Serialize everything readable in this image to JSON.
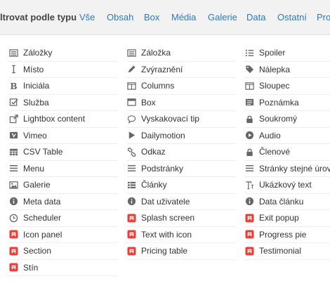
{
  "filter": {
    "label": "ltrovat podle typu",
    "tabs": [
      "Vše",
      "Obsah",
      "Box",
      "Média",
      "Galerie",
      "Data",
      "Ostatní",
      "Pro"
    ]
  },
  "columns": [
    [
      {
        "label": "Záložky",
        "icon": "list-icon"
      },
      {
        "label": "Místo",
        "icon": "spacer-icon"
      },
      {
        "label": "Iniciála",
        "icon": "dropcap-icon"
      },
      {
        "label": "Služba",
        "icon": "check-square-icon"
      },
      {
        "label": "Lightbox content",
        "icon": "external-link-icon"
      },
      {
        "label": "Vimeo",
        "icon": "vimeo-icon"
      },
      {
        "label": "CSV Table",
        "icon": "table-icon"
      },
      {
        "label": "Menu",
        "icon": "menu-icon"
      },
      {
        "label": "Galerie",
        "icon": "image-icon"
      },
      {
        "label": "Meta data",
        "icon": "info-icon"
      },
      {
        "label": "Scheduler",
        "icon": "clock-icon"
      },
      {
        "label": "Icon panel",
        "icon": "red-addon-icon"
      },
      {
        "label": "Section",
        "icon": "red-addon-icon"
      },
      {
        "label": "Stín",
        "icon": "red-addon-icon"
      }
    ],
    [
      {
        "label": "Záložka",
        "icon": "list-icon"
      },
      {
        "label": "Zvýraznění",
        "icon": "pencil-icon"
      },
      {
        "label": "Columns",
        "icon": "columns-icon"
      },
      {
        "label": "Box",
        "icon": "box-icon"
      },
      {
        "label": "Vyskakovací tip",
        "icon": "comment-icon"
      },
      {
        "label": "Dailymotion",
        "icon": "play-icon"
      },
      {
        "label": "Odkaz",
        "icon": "link-icon"
      },
      {
        "label": "Podstránky",
        "icon": "menu-icon"
      },
      {
        "label": "Články",
        "icon": "th-list-icon"
      },
      {
        "label": "Dat uživatele",
        "icon": "info-icon"
      },
      {
        "label": "Splash screen",
        "icon": "red-addon-icon"
      },
      {
        "label": "Text with icon",
        "icon": "red-addon-icon"
      },
      {
        "label": "Pricing table",
        "icon": "red-addon-icon"
      }
    ],
    [
      {
        "label": "Spoiler",
        "icon": "list-ul-icon"
      },
      {
        "label": "Nálepka",
        "icon": "tag-icon"
      },
      {
        "label": "Sloupec",
        "icon": "columns-icon"
      },
      {
        "label": "Poznámka",
        "icon": "note-icon"
      },
      {
        "label": "Soukromý",
        "icon": "lock-icon"
      },
      {
        "label": "Audio",
        "icon": "play-circle-icon"
      },
      {
        "label": "Členové",
        "icon": "lock-icon"
      },
      {
        "label": "Stránky stejné úrovně",
        "icon": "menu-icon"
      },
      {
        "label": "Ukázkový text",
        "icon": "text-height-icon"
      },
      {
        "label": "Data článku",
        "icon": "info-icon"
      },
      {
        "label": "Exit popup",
        "icon": "red-addon-icon"
      },
      {
        "label": "Progress pie",
        "icon": "red-addon-icon"
      },
      {
        "label": "Testimonial",
        "icon": "red-addon-icon"
      }
    ]
  ],
  "colors": {
    "accent": "#2e79b9",
    "addon": "#e8403a",
    "icon": "#666666"
  }
}
